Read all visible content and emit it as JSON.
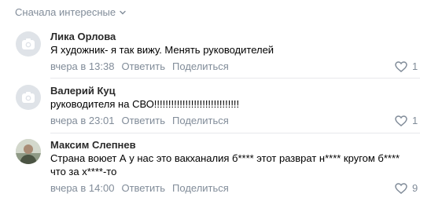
{
  "sort": {
    "label": "Сначала интересные",
    "icon": "chevron-down-icon"
  },
  "comments": [
    {
      "author": "Лика Орлова",
      "avatar": "camera-placeholder-icon",
      "lines": [
        "Я художник- я так вижу. Менять руководителей"
      ],
      "date": "вчера в 13:38",
      "reply": "Ответить",
      "share": "Поделиться",
      "likes": "1"
    },
    {
      "author": "Валерий Куц",
      "avatar": "camera-placeholder-icon",
      "lines": [
        "руководителя на СВО!!!!!!!!!!!!!!!!!!!!!!!!!!!!!!"
      ],
      "date": "вчера в 23:01",
      "reply": "Ответить",
      "share": "Поделиться",
      "likes": "1"
    },
    {
      "author": "Максим Слепнев",
      "avatar": "user-photo",
      "lines": [
        "Страна воюет А у нас это вакханалия б**** этот разврат н**** кругом б****",
        "что за х****-то"
      ],
      "date": "вчера в 14:00",
      "reply": "Ответить",
      "share": "Поделиться",
      "likes": "9"
    }
  ],
  "colors": {
    "meta": "#818c99",
    "divider": "#e7e8ec",
    "avatar_bg": "#dfe3e8"
  }
}
